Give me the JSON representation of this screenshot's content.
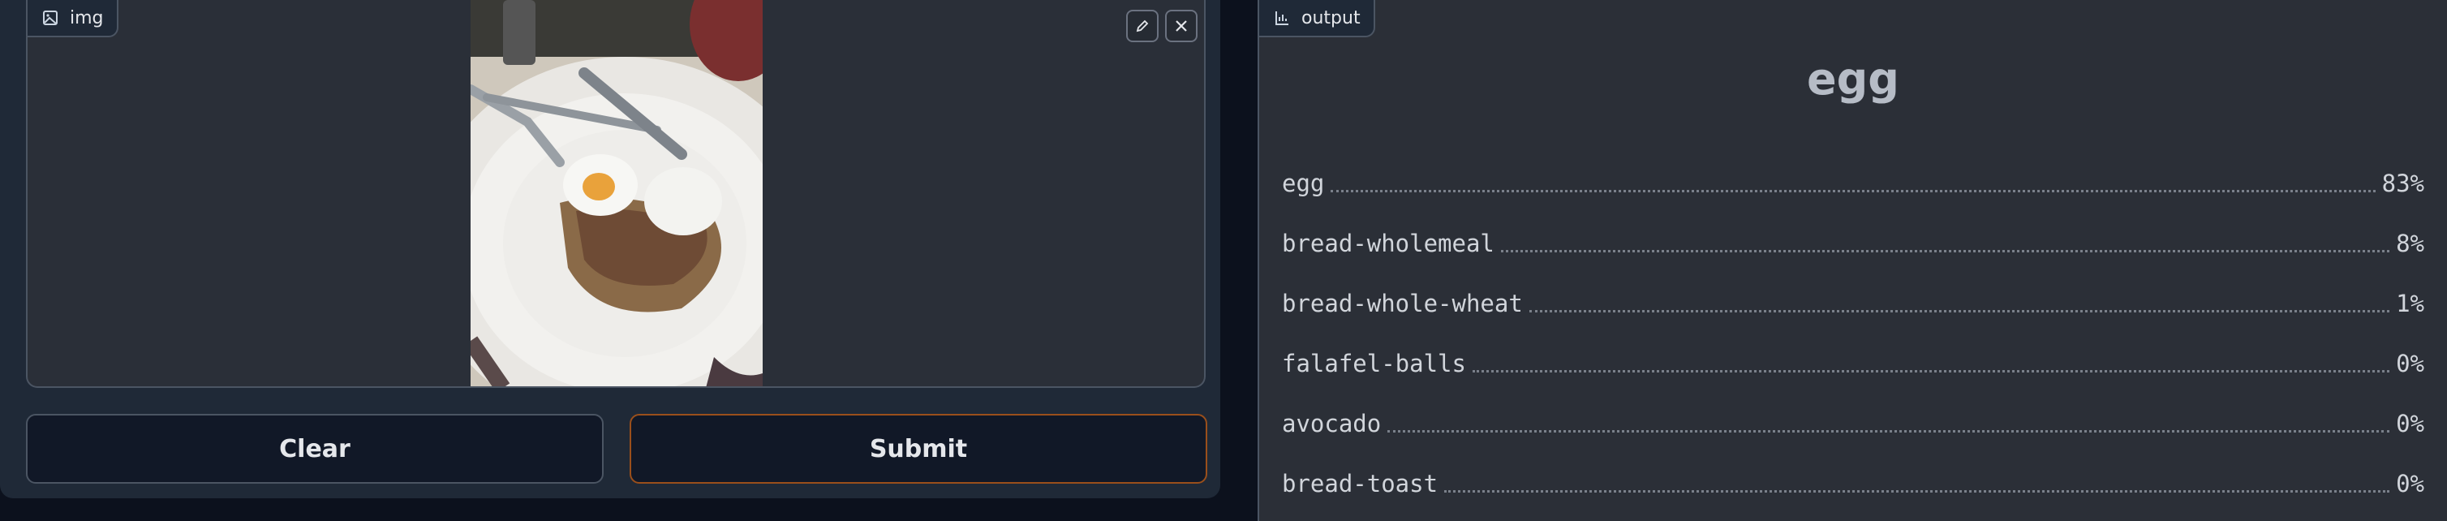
{
  "input_panel": {
    "label": "img",
    "image_description": "white plate with halved boiled egg on toast and forks"
  },
  "buttons": {
    "clear": "Clear",
    "submit": "Submit"
  },
  "output_panel": {
    "label": "output",
    "top_label": "egg",
    "confidences": [
      {
        "label": "egg",
        "value": "83%"
      },
      {
        "label": "bread-wholemeal",
        "value": "8%"
      },
      {
        "label": "bread-whole-wheat",
        "value": "1%"
      },
      {
        "label": "falafel-balls",
        "value": "0%"
      },
      {
        "label": "avocado",
        "value": "0%"
      },
      {
        "label": "bread-toast",
        "value": "0%"
      }
    ]
  },
  "colors": {
    "accent_submit_border": "#9a4f1b",
    "panel_bg": "#2a2f38",
    "page_bg": "#0c111d"
  }
}
